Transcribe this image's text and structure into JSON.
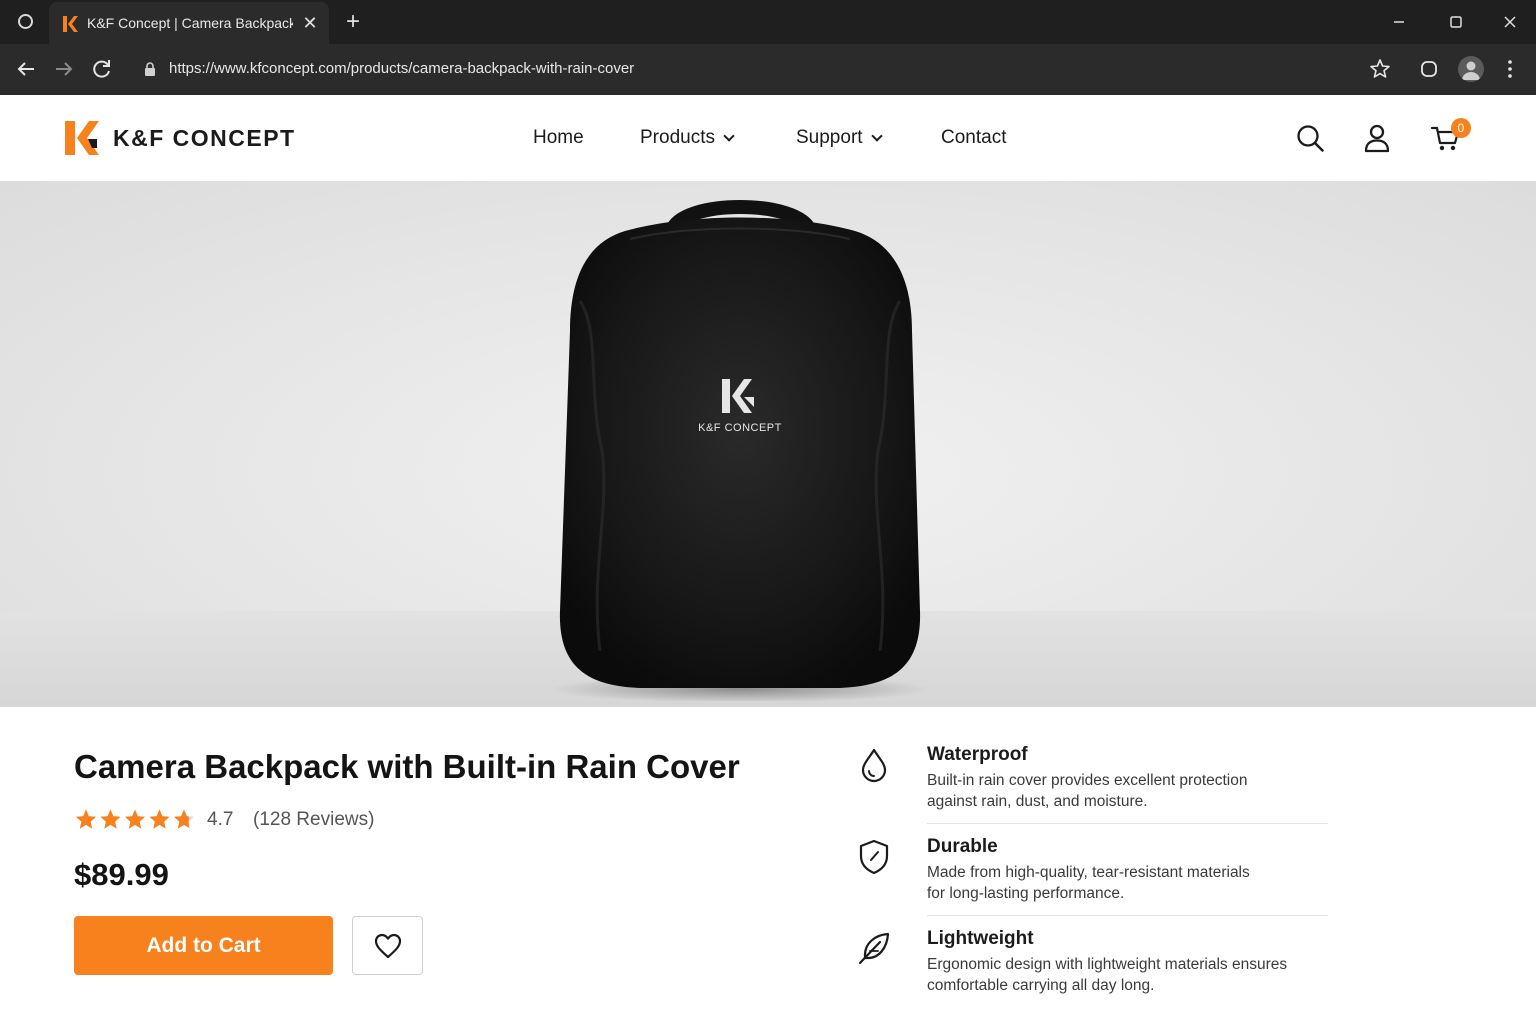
{
  "browser": {
    "tab_title": "K&F Concept | Camera Backpack",
    "url": "https://www.kfconcept.com/products/camera-backpack-with-rain-cover",
    "tab_close_glyph": "✕",
    "new_tab_glyph": "+"
  },
  "header": {
    "brand": "K&F CONCEPT",
    "nav": [
      {
        "label": "Home",
        "has_dropdown": false
      },
      {
        "label": "Products",
        "has_dropdown": true
      },
      {
        "label": "Support",
        "has_dropdown": true
      },
      {
        "label": "Contact",
        "has_dropdown": false
      }
    ],
    "icons": [
      "search-icon",
      "account-icon",
      "cart-icon"
    ],
    "cart_count": "0"
  },
  "hero": {
    "product_brand_print": "K&F CONCEPT"
  },
  "product": {
    "title": "Camera Backpack with Built-in Rain Cover",
    "rating": "4.7",
    "rating_stars": 4.7,
    "review_count": "(128 Reviews)",
    "price": "$89.99",
    "add_to_cart": "Add to Cart"
  },
  "features": [
    {
      "icon": "water-drop-icon",
      "title": "Waterproof",
      "desc_lines": [
        "Built-in rain cover provides excellent protection",
        "against rain, dust, and moisture."
      ]
    },
    {
      "icon": "shield-icon",
      "title": "Durable",
      "desc_lines": [
        "Made from high-quality, tear-resistant materials",
        "for long-lasting performance."
      ]
    },
    {
      "icon": "feather-icon",
      "title": "Lightweight",
      "desc_lines": [
        "Ergonomic design with lightweight materials ensures",
        "comfortable carrying all day long."
      ]
    }
  ],
  "colors": {
    "accent": "#f7811c",
    "chrome_dark": "#1f1f1f",
    "chrome_toolbar": "#2b2b2b",
    "text": "#1b1b1b"
  }
}
